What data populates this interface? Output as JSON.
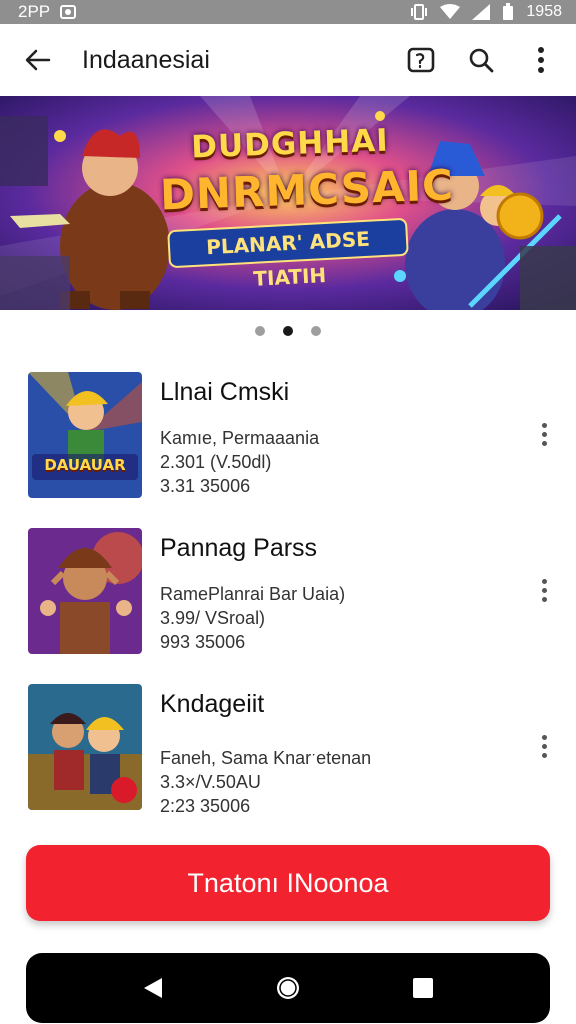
{
  "status_bar": {
    "time": "2PP",
    "right_text": "1958",
    "icons": [
      "notification-icon",
      "vibrate-icon",
      "wifi-icon",
      "signal-icon",
      "battery-icon"
    ]
  },
  "app_bar": {
    "title": "Indaanesiai",
    "icons": [
      "back-arrow-icon",
      "cast-icon",
      "search-icon",
      "more-vert-icon"
    ]
  },
  "banner": {
    "title_line1": "DUDGHHAI",
    "title_line2": "DNRMCSAIC",
    "subtitle": "PLANAR' ADSE TIATIH"
  },
  "carousel": {
    "pages": 3,
    "active_index": 1
  },
  "games": [
    {
      "title": "Llnai Cmski",
      "line1": "Kamıe, Permaaania",
      "line2": "2.301 (V.50dl)",
      "line3": "3.31 35006",
      "thumb_label": "DAUAUAR"
    },
    {
      "title": "Pannag Parss",
      "line1": "RamePlanrai Bar Uaia)",
      "line2": "3.99/ VSroal)",
      "line3": "993 35006",
      "thumb_label": ""
    },
    {
      "title": "Kndageiit",
      "line1": "Faneh, Sama Knarˑetenan",
      "line2": "3.3×/V.50AU",
      "line3": "2:23 35006",
      "thumb_label": ""
    }
  ],
  "cta": {
    "label": "Tnatonı INoonoa"
  },
  "nav": {
    "icons": [
      "back-triangle-icon",
      "home-circle-icon",
      "recents-square-icon"
    ]
  },
  "colors": {
    "accent": "#f2222e",
    "status_bar": "#8f8f8f",
    "nav_bar": "#000000"
  }
}
